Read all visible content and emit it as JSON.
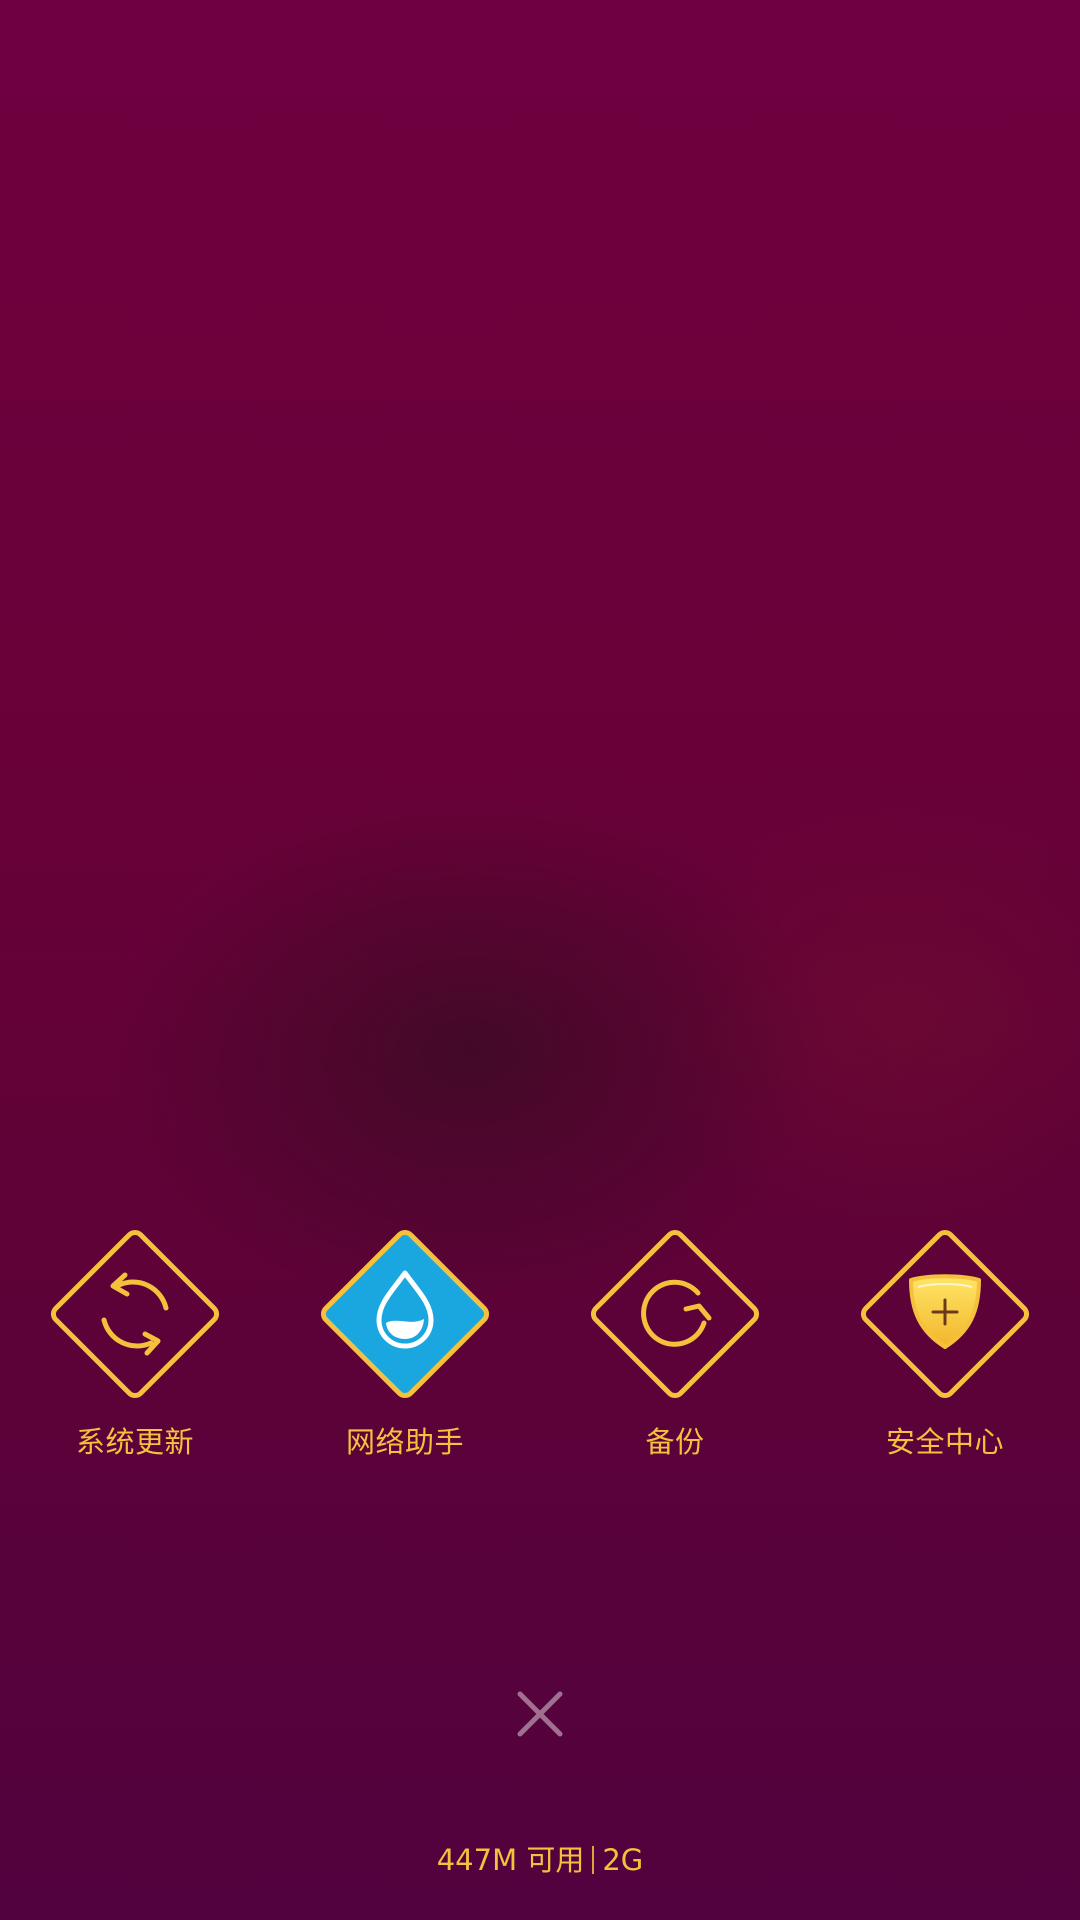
{
  "colors": {
    "accent_gold": "#f5c13d",
    "highlight_blue": "#1aa7e0",
    "background_top": "#6e0140",
    "background_bottom": "#52023e",
    "close_icon": "#a07090"
  },
  "quick_apps": [
    {
      "label": "系统更新",
      "icon": "refresh-arrows-icon",
      "highlighted": false
    },
    {
      "label": "网络助手",
      "icon": "water-drop-icon",
      "highlighted": true
    },
    {
      "label": "备份",
      "icon": "circular-arrow-icon",
      "highlighted": false
    },
    {
      "label": "安全中心",
      "icon": "shield-plus-icon",
      "highlighted": false
    }
  ],
  "close": {
    "icon": "close-icon"
  },
  "memory": {
    "available": "447M 可用",
    "total": "2G"
  }
}
